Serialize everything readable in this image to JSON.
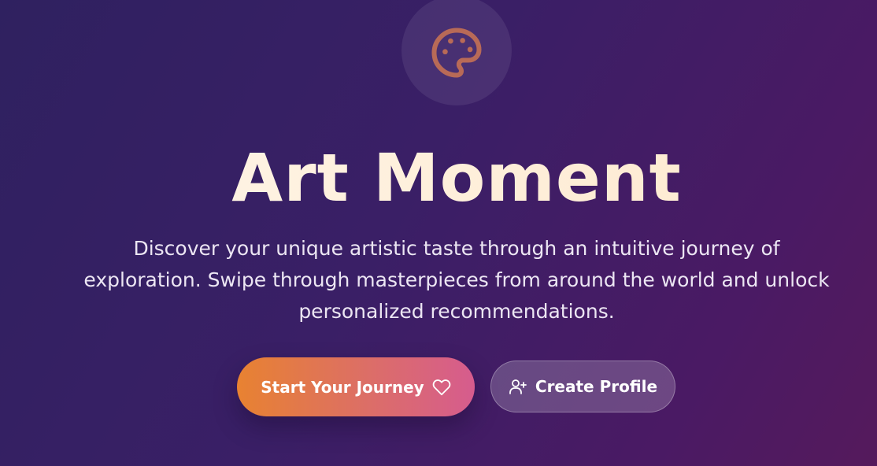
{
  "hero": {
    "logo_icon": "palette-icon",
    "title": "Art Moment",
    "subtitle": "Discover your unique artistic taste through an intuitive journey of exploration. Swipe through masterpieces from around the world and unlock personalized recommendations."
  },
  "actions": {
    "primary_label": "Start Your Journey",
    "primary_icon": "heart-icon",
    "secondary_label": "Create Profile",
    "secondary_icon": "user-plus-icon"
  },
  "colors": {
    "background_start": "#2f2160",
    "background_end": "#551a5c",
    "primary_gradient_start": "#e88231",
    "primary_gradient_end": "#d65c8e",
    "palette_icon": "#b86a57",
    "title": "#fdf0dc"
  }
}
